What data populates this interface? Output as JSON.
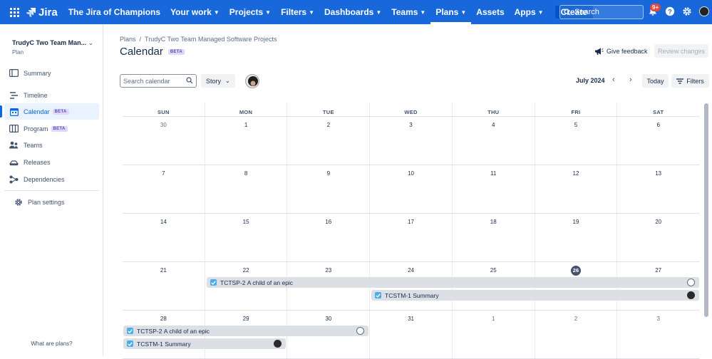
{
  "topnav": {
    "product": "Jira",
    "site": "The Jira of Champions",
    "items": [
      {
        "label": "Your work",
        "chevron": true
      },
      {
        "label": "Projects",
        "chevron": true
      },
      {
        "label": "Filters",
        "chevron": true
      },
      {
        "label": "Dashboards",
        "chevron": true
      },
      {
        "label": "Teams",
        "chevron": true
      },
      {
        "label": "Plans",
        "chevron": true,
        "active": true
      },
      {
        "label": "Assets",
        "chevron": false
      },
      {
        "label": "Apps",
        "chevron": true
      }
    ],
    "create_label": "Create",
    "search_placeholder": "Search",
    "notifications_badge": "9+",
    "brand_color": "#1868db"
  },
  "sidebar": {
    "project_name": "TrudyC Two Team Man...",
    "project_type": "Plan",
    "items": [
      {
        "label": "Summary",
        "icon": "summary-icon"
      },
      {
        "label": "Timeline",
        "icon": "timeline-icon"
      },
      {
        "label": "Calendar",
        "icon": "calendar-icon",
        "badge": "BETA",
        "active": true
      },
      {
        "label": "Program",
        "icon": "program-icon",
        "badge": "BETA"
      },
      {
        "label": "Teams",
        "icon": "teams-icon"
      },
      {
        "label": "Releases",
        "icon": "releases-icon"
      },
      {
        "label": "Dependencies",
        "icon": "dependencies-icon"
      }
    ],
    "settings_label": "Plan settings",
    "footer_link": "What are plans?"
  },
  "header": {
    "breadcrumb": [
      "Plans",
      "TrudyC Two Team Managed Software Projects"
    ],
    "title": "Calendar",
    "title_badge": "BETA",
    "feedback_label": "Give feedback",
    "review_label": "Review changes"
  },
  "toolbar": {
    "search_placeholder": "Search calendar",
    "issue_type": "Story",
    "month_label": "July 2024",
    "today_label": "Today",
    "filters_label": "Filters"
  },
  "calendar": {
    "weekdays": [
      "SUN",
      "MON",
      "TUE",
      "WED",
      "THU",
      "FRI",
      "SAT"
    ],
    "weeks": [
      [
        "30",
        "1",
        "2",
        "3",
        "4",
        "5",
        "6"
      ],
      [
        "7",
        "8",
        "9",
        "10",
        "11",
        "12",
        "13"
      ],
      [
        "14",
        "15",
        "16",
        "17",
        "18",
        "19",
        "20"
      ],
      [
        "21",
        "22",
        "23",
        "24",
        "25",
        "26",
        "27"
      ],
      [
        "28",
        "29",
        "30",
        "31",
        "1",
        "2",
        "3"
      ]
    ],
    "today": "26",
    "events": [
      {
        "key": "TCTSP-2",
        "summary": "A child of an epic",
        "avatar": "empty"
      },
      {
        "key": "TCSTM-1",
        "summary": "Summary",
        "avatar": "photo"
      },
      {
        "key": "TCTSP-2",
        "summary": "A child of an epic",
        "avatar": "empty"
      },
      {
        "key": "TCSTM-1",
        "summary": "Summary",
        "avatar": "photo"
      }
    ]
  }
}
